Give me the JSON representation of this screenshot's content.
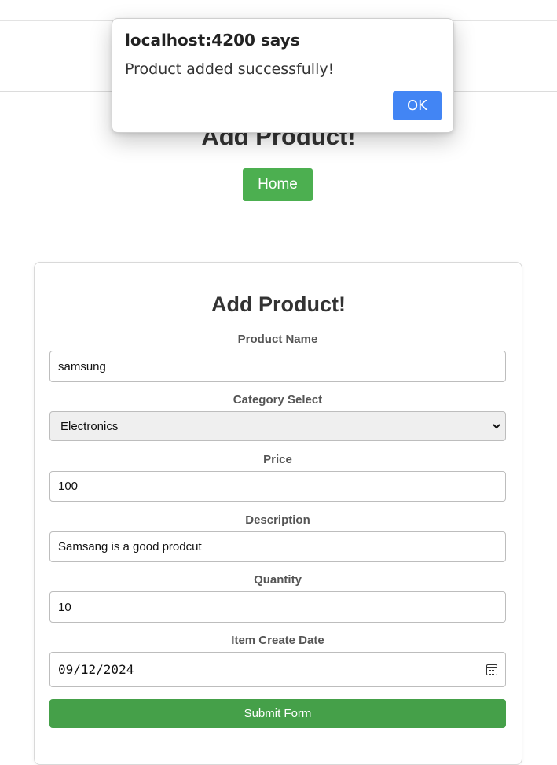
{
  "page": {
    "heading": "Add Product!",
    "home_button": "Home"
  },
  "form": {
    "title": "Add Product!",
    "product_name_label": "Product Name",
    "product_name_value": "samsung",
    "category_label": "Category Select",
    "category_value": "Electronics",
    "price_label": "Price",
    "price_value": "100",
    "description_label": "Description",
    "description_value": "Samsang is a good prodcut",
    "quantity_label": "Quantity",
    "quantity_value": "10",
    "date_label": "Item Create Date",
    "date_value": "09/12/2024",
    "submit_label": "Submit Form"
  },
  "dialog": {
    "title": "localhost:4200 says",
    "message": "Product added successfully!",
    "ok_label": "OK"
  },
  "colors": {
    "home_button": "#4caf50",
    "submit_button": "#45a049",
    "ok_button": "#4285f4"
  },
  "icons": {
    "select_chevron": "chevron-down-icon",
    "date_picker": "calendar-icon"
  }
}
